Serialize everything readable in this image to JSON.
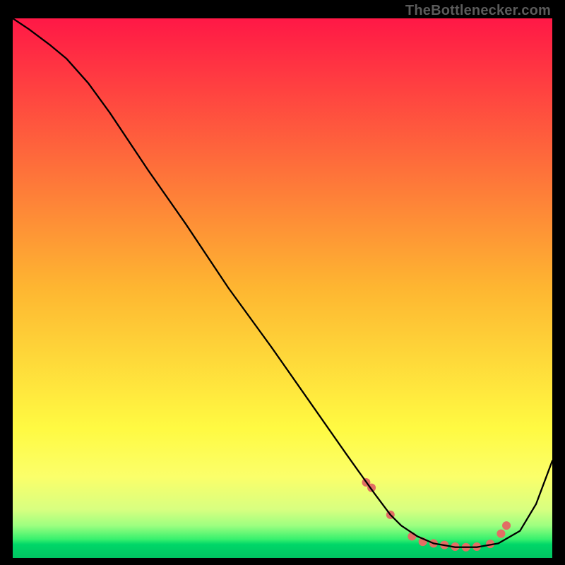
{
  "watermark": "TheBottlenecker.com",
  "chart_data": {
    "type": "line",
    "title": "",
    "xlabel": "",
    "ylabel": "",
    "xlim": [
      0,
      100
    ],
    "ylim": [
      0,
      100
    ],
    "grid": false,
    "gradient": {
      "bands": [
        {
          "stop": 0.0,
          "color": "#ff1846"
        },
        {
          "stop": 0.5,
          "color": "#feb631"
        },
        {
          "stop": 0.76,
          "color": "#fffa42"
        },
        {
          "stop": 0.85,
          "color": "#fbff6a"
        },
        {
          "stop": 0.91,
          "color": "#d8ff80"
        },
        {
          "stop": 0.94,
          "color": "#9dff80"
        },
        {
          "stop": 0.965,
          "color": "#39f16e"
        },
        {
          "stop": 0.975,
          "color": "#00d668"
        },
        {
          "stop": 1.0,
          "color": "#00c562"
        }
      ]
    },
    "series": [
      {
        "name": "curve",
        "stroke": "#000000",
        "strokeWidth": 2.3,
        "x": [
          0,
          3,
          7,
          10,
          14,
          18,
          25,
          32,
          40,
          48,
          55,
          62,
          67,
          70,
          72,
          75,
          78,
          82,
          86,
          90,
          94,
          97,
          100
        ],
        "y": [
          100,
          98,
          95,
          92.5,
          88,
          82.5,
          72,
          62,
          50,
          39,
          29,
          19,
          12,
          8,
          6,
          4,
          2.7,
          2,
          2,
          2.7,
          5,
          10,
          18
        ]
      }
    ],
    "markers": {
      "name": "dots",
      "color": "#e26e64",
      "radius": 6,
      "points": [
        {
          "x": 65.5,
          "y": 14
        },
        {
          "x": 66.5,
          "y": 13
        },
        {
          "x": 70,
          "y": 8
        },
        {
          "x": 74,
          "y": 4
        },
        {
          "x": 76,
          "y": 3
        },
        {
          "x": 78,
          "y": 2.7
        },
        {
          "x": 80,
          "y": 2.4
        },
        {
          "x": 82,
          "y": 2.1
        },
        {
          "x": 84,
          "y": 2.0
        },
        {
          "x": 86,
          "y": 2.1
        },
        {
          "x": 88.5,
          "y": 2.6
        },
        {
          "x": 90.5,
          "y": 4.5
        },
        {
          "x": 91.5,
          "y": 6
        }
      ]
    }
  }
}
